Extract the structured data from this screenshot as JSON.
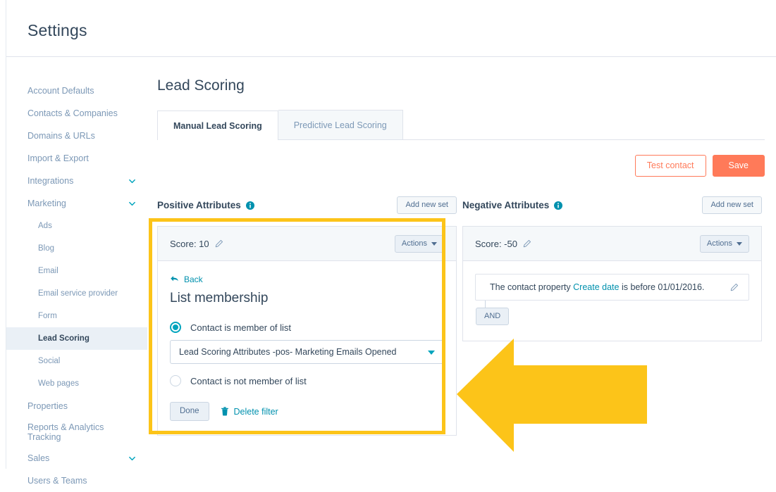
{
  "header": {
    "title": "Settings"
  },
  "sidebar": {
    "items": [
      {
        "label": "Account Defaults",
        "level": "top",
        "expandable": false,
        "active": false
      },
      {
        "label": "Contacts & Companies",
        "level": "top",
        "expandable": false,
        "active": false
      },
      {
        "label": "Domains & URLs",
        "level": "top",
        "expandable": false,
        "active": false
      },
      {
        "label": "Import & Export",
        "level": "top",
        "expandable": false,
        "active": false
      },
      {
        "label": "Integrations",
        "level": "top",
        "expandable": true,
        "active": false
      },
      {
        "label": "Marketing",
        "level": "top",
        "expandable": true,
        "active": false
      },
      {
        "label": "Ads",
        "level": "sub",
        "expandable": false,
        "active": false
      },
      {
        "label": "Blog",
        "level": "sub",
        "expandable": false,
        "active": false
      },
      {
        "label": "Email",
        "level": "sub",
        "expandable": false,
        "active": false
      },
      {
        "label": "Email service provider",
        "level": "sub",
        "expandable": false,
        "active": false
      },
      {
        "label": "Form",
        "level": "sub",
        "expandable": false,
        "active": false
      },
      {
        "label": "Lead Scoring",
        "level": "sub",
        "expandable": false,
        "active": true
      },
      {
        "label": "Social",
        "level": "sub",
        "expandable": false,
        "active": false
      },
      {
        "label": "Web pages",
        "level": "sub",
        "expandable": false,
        "active": false
      },
      {
        "label": "Properties",
        "level": "top",
        "expandable": false,
        "active": false
      },
      {
        "label": "Reports & Analytics",
        "label2": "Tracking",
        "level": "top",
        "expandable": false,
        "active": false
      },
      {
        "label": "Sales",
        "level": "top",
        "expandable": true,
        "active": false
      },
      {
        "label": "Users & Teams",
        "level": "top",
        "expandable": false,
        "active": false
      }
    ]
  },
  "main": {
    "page_title": "Lead Scoring",
    "tabs": [
      {
        "label": "Manual Lead Scoring",
        "active": true
      },
      {
        "label": "Predictive Lead Scoring",
        "active": false
      }
    ],
    "test_contact_label": "Test contact",
    "save_label": "Save"
  },
  "positive": {
    "section_title": "Positive Attributes",
    "add_new_set_label": "Add new set",
    "score_label": "Score: 10",
    "actions_label": "Actions",
    "back_label": "Back",
    "filter_heading": "List membership",
    "radio_member_label": "Contact is member of list",
    "radio_not_member_label": "Contact is not member of list",
    "selected_list": "Lead Scoring Attributes -pos- Marketing Emails Opened",
    "done_label": "Done",
    "delete_filter_label": "Delete filter"
  },
  "negative": {
    "section_title": "Negative Attributes",
    "add_new_set_label": "Add new set",
    "score_label": "Score: -50",
    "actions_label": "Actions",
    "filter_prefix": "The contact property",
    "filter_property": "Create date",
    "filter_suffix": "is before 01/01/2016.",
    "and_label": "AND"
  },
  "annotation": {
    "highlight_color": "#fcc419",
    "arrow_color": "#fcc419",
    "arrow_direction": "left"
  },
  "colors": {
    "accent_orange": "#ff7a59",
    "accent_teal": "#00a4bd",
    "link_teal": "#0091ae",
    "text_dark": "#33475b",
    "text_muted": "#7c98b6",
    "panel_bg": "#f5f8fa",
    "border": "#dfe3eb",
    "highlight_yellow": "#fcc419"
  }
}
